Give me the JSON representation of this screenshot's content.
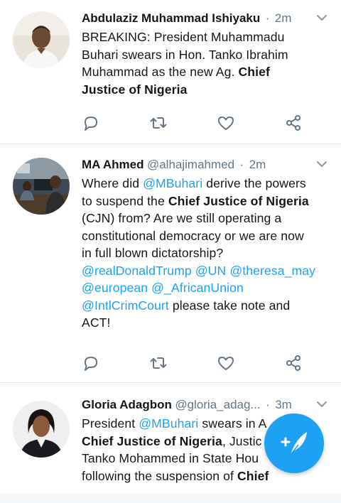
{
  "tweets": [
    {
      "name": "Abdulaziz Muhammad Ishiyaku",
      "handle": "",
      "sep": "·",
      "time": "2m",
      "lines": [
        [
          {
            "t": "BREAKING: President Muhammadu"
          }
        ],
        [
          {
            "t": "Buhari swears in Hon. Tanko Ibrahim"
          }
        ],
        [
          {
            "t": "Muhammad as the new Ag. "
          },
          {
            "t": "Chief",
            "b": true
          }
        ],
        [
          {
            "t": "Justice of Nigeria",
            "b": true
          }
        ]
      ]
    },
    {
      "name": "MA Ahmed",
      "handle": "@alhajimahmed",
      "sep": "·",
      "time": "2m",
      "lines": [
        [
          {
            "t": "Where did "
          },
          {
            "t": "@MBuhari",
            "m": true
          },
          {
            "t": " derive the powers"
          }
        ],
        [
          {
            "t": "to suspend the "
          },
          {
            "t": "Chief Justice of Nigeria",
            "b": true
          }
        ],
        [
          {
            "t": "(CJN) from? Are we still operating a"
          }
        ],
        [
          {
            "t": "constitutional democracy or we are now"
          }
        ],
        [
          {
            "t": "in full blown dictatorship?"
          }
        ],
        [
          {
            "t": "@realDonaldTrump",
            "m": true
          },
          {
            "t": " "
          },
          {
            "t": "@UN",
            "m": true
          },
          {
            "t": " "
          },
          {
            "t": "@theresa_may",
            "m": true
          }
        ],
        [
          {
            "t": "@european",
            "m": true
          },
          {
            "t": " "
          },
          {
            "t": "@_AfricanUnion",
            "m": true
          }
        ],
        [
          {
            "t": "@IntlCrimCourt",
            "m": true
          },
          {
            "t": " please take note and"
          }
        ],
        [
          {
            "t": "ACT!"
          }
        ]
      ]
    },
    {
      "name": "Gloria Adagbon",
      "handle": "@gloria_adag...",
      "sep": "·",
      "time": "3m",
      "lines": [
        [
          {
            "t": "President "
          },
          {
            "t": "@MBuhari",
            "m": true
          },
          {
            "t": " swears in A"
          }
        ],
        [
          {
            "t": "Chief Justice of Nigeria",
            "b": true
          },
          {
            "t": ", Justic"
          }
        ],
        [
          {
            "t": "Tanko Mohammed in State Hou"
          }
        ],
        [
          {
            "t": "following the suspension of "
          },
          {
            "t": "Chief",
            "b": true
          }
        ]
      ]
    }
  ],
  "icons": {
    "reply": "reply-icon",
    "retweet": "retweet-icon",
    "like": "heart-icon",
    "share": "share-icon",
    "compose": "compose-icon",
    "caret": "chevron-down-icon"
  },
  "colors": {
    "accent": "#1da1f2",
    "text": "#14171a",
    "secondary": "#657786",
    "divider": "#e1e8ed"
  }
}
